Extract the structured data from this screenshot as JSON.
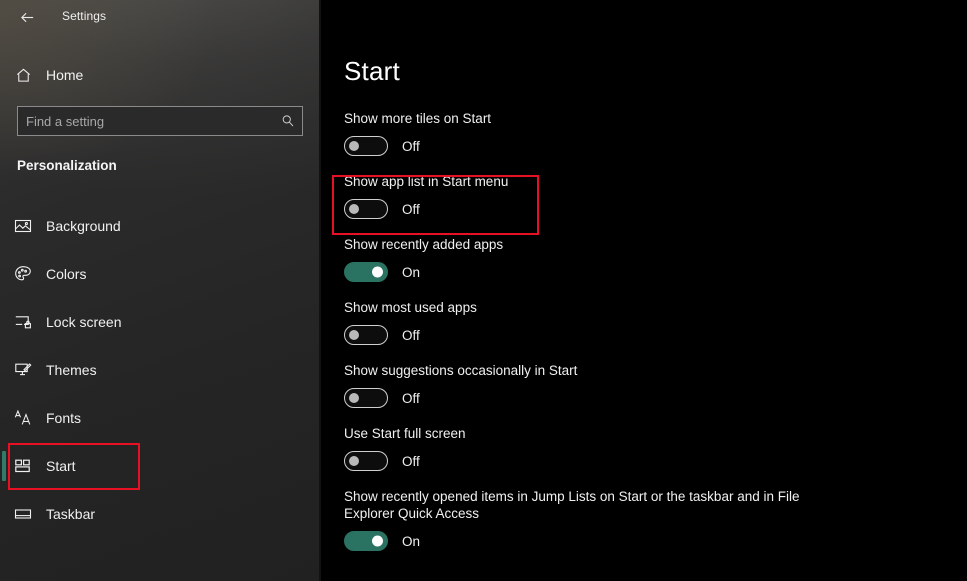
{
  "window": {
    "title": "Settings",
    "back_icon": "back-arrow-icon",
    "controls": {
      "minimize": "minimize-icon",
      "maximize": "maximize-icon",
      "close": "close-icon"
    }
  },
  "sidebar": {
    "home": {
      "label": "Home",
      "icon": "home-icon"
    },
    "search": {
      "placeholder": "Find a setting",
      "value": "",
      "icon": "search-icon"
    },
    "section_title": "Personalization",
    "items": [
      {
        "label": "Background",
        "icon": "picture-icon",
        "selected": false
      },
      {
        "label": "Colors",
        "icon": "palette-icon",
        "selected": false
      },
      {
        "label": "Lock screen",
        "icon": "lock-screen-icon",
        "selected": false
      },
      {
        "label": "Themes",
        "icon": "themes-icon",
        "selected": false
      },
      {
        "label": "Fonts",
        "icon": "fonts-icon",
        "selected": false
      },
      {
        "label": "Start",
        "icon": "start-tiles-icon",
        "selected": true
      },
      {
        "label": "Taskbar",
        "icon": "taskbar-icon",
        "selected": false
      }
    ]
  },
  "main": {
    "page_title": "Start",
    "settings": [
      {
        "label": "Show more tiles on Start",
        "state": "Off",
        "on": false
      },
      {
        "label": "Show app list in Start menu",
        "state": "Off",
        "on": false
      },
      {
        "label": "Show recently added apps",
        "state": "On",
        "on": true
      },
      {
        "label": "Show most used apps",
        "state": "Off",
        "on": false
      },
      {
        "label": "Show suggestions occasionally in Start",
        "state": "Off",
        "on": false
      },
      {
        "label": "Use Start full screen",
        "state": "Off",
        "on": false
      },
      {
        "label": "Show recently opened items in Jump Lists on Start or the taskbar and in File Explorer Quick Access",
        "state": "On",
        "on": true
      }
    ]
  },
  "annotations": [
    {
      "name": "highlight-start-nav",
      "color": "#e81123"
    },
    {
      "name": "highlight-show-app-list-setting",
      "color": "#e81123"
    }
  ],
  "colors": {
    "accent_teal": "#2a7262",
    "selection_bar": "#2f7a68",
    "annotation_red": "#e81123",
    "main_background": "#000000"
  }
}
